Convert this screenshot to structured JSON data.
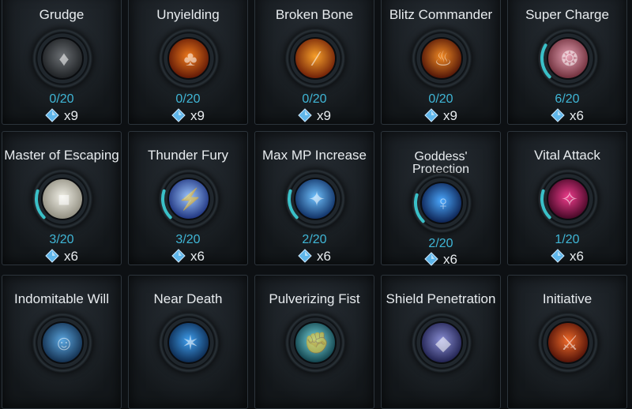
{
  "colors": {
    "level_text": "#3fb6d6",
    "progress_arc": "#3ac0c8",
    "crystal": "#5fb6ea"
  },
  "icons": {
    "crystal": "blue-crystal-icon"
  },
  "skills": [
    {
      "name": "Grudge",
      "level": "0/20",
      "cost": "x9",
      "progress": 0,
      "art": "dark-wolf",
      "c1": "#6b6f73",
      "c2": "#1b1e21"
    },
    {
      "name": "Unyielding",
      "level": "0/20",
      "cost": "x9",
      "progress": 0,
      "art": "fiery-figure",
      "c1": "#f07a1c",
      "c2": "#5a1405"
    },
    {
      "name": "Broken Bone",
      "level": "0/20",
      "cost": "x9",
      "progress": 0,
      "art": "orange-slash",
      "c1": "#f8a02a",
      "c2": "#6a1a06"
    },
    {
      "name": "Blitz Commander",
      "level": "0/20",
      "cost": "x9",
      "progress": 0,
      "art": "flame-army",
      "c1": "#f28a24",
      "c2": "#4a1006"
    },
    {
      "name": "Super Charge",
      "level": "6/20",
      "cost": "x6",
      "progress": 0.3,
      "art": "pink-warrior",
      "c1": "#e6a2b4",
      "c2": "#6a2a36"
    },
    {
      "name": "Master of Escaping",
      "level": "3/20",
      "cost": "x6",
      "progress": 0.15,
      "art": "boot",
      "c1": "#f0efe6",
      "c2": "#8d8a7c"
    },
    {
      "name": "Thunder Fury",
      "level": "3/20",
      "cost": "x6",
      "progress": 0.15,
      "art": "lightning",
      "c1": "#9cc6ff",
      "c2": "#1a2e7a"
    },
    {
      "name": "Max MP Increase",
      "level": "2/20",
      "cost": "x6",
      "progress": 0.1,
      "art": "mana-hands",
      "c1": "#6fc2ff",
      "c2": "#0c2a5e"
    },
    {
      "name": "Goddess' Protection",
      "level": "2/20",
      "cost": "x6",
      "progress": 0.1,
      "art": "goddess",
      "c1": "#4aa8ff",
      "c2": "#0a1c4a"
    },
    {
      "name": "Vital Attack",
      "level": "1/20",
      "cost": "x6",
      "progress": 0.05,
      "art": "pink-strike",
      "c1": "#f03c8c",
      "c2": "#3e0622"
    },
    {
      "name": "Indomitable Will",
      "level": "",
      "cost": "",
      "progress": 0,
      "art": "fighter",
      "c1": "#5aa6e0",
      "c2": "#102a48"
    },
    {
      "name": "Near Death",
      "level": "",
      "cost": "",
      "progress": 0,
      "art": "ghost-runner",
      "c1": "#3fa0f0",
      "c2": "#0a2448"
    },
    {
      "name": "Pulverizing Fist",
      "level": "",
      "cost": "",
      "progress": 0,
      "art": "fist-shield",
      "c1": "#7ee0e6",
      "c2": "#0c3a44"
    },
    {
      "name": "Shield Penetration",
      "level": "",
      "cost": "",
      "progress": 0,
      "art": "shield",
      "c1": "#8a8fd6",
      "c2": "#1c1d4a"
    },
    {
      "name": "Initiative",
      "level": "",
      "cost": "",
      "progress": 0,
      "art": "fire-sword",
      "c1": "#f06a2a",
      "c2": "#4a0e06"
    }
  ]
}
